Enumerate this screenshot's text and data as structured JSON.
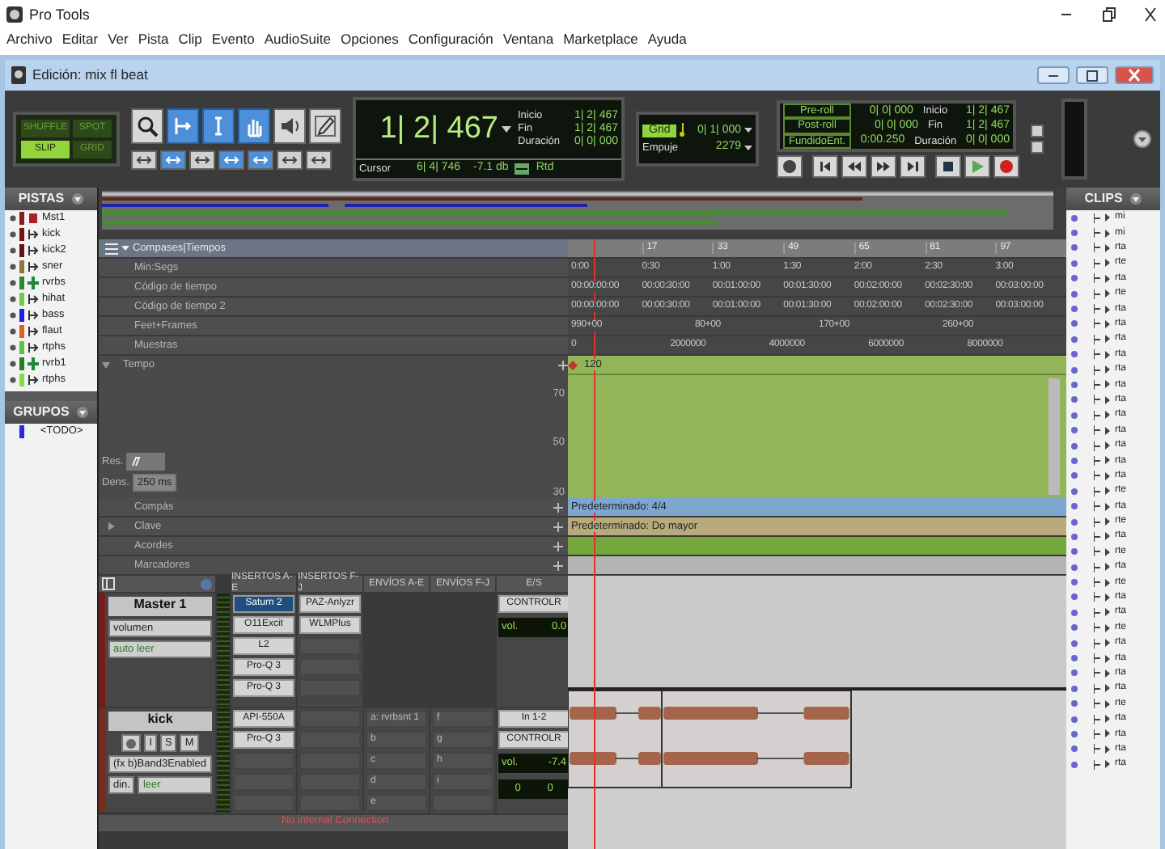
{
  "window": {
    "title": "Pro Tools"
  },
  "menu": [
    "Archivo",
    "Editar",
    "Ver",
    "Pista",
    "Clip",
    "Evento",
    "AudioSuite",
    "Opciones",
    "Configuración",
    "Ventana",
    "Marketplace",
    "Ayuda"
  ],
  "document": {
    "title": "Edición: mix fl beat"
  },
  "edit_modes": [
    {
      "label": "SHUFFLE",
      "selected": false
    },
    {
      "label": "SPOT",
      "selected": false
    },
    {
      "label": "SLIP",
      "selected": true
    },
    {
      "label": "GRID",
      "selected": false
    }
  ],
  "tools": [
    {
      "kind": "zoom",
      "selected": false
    },
    {
      "kind": "trim",
      "selected": true
    },
    {
      "kind": "selector",
      "selected": true
    },
    {
      "kind": "grabber",
      "selected": true
    },
    {
      "kind": "scrub",
      "selected": false
    },
    {
      "kind": "pencil",
      "selected": false
    }
  ],
  "edit_options": [
    {
      "selected": false
    },
    {
      "selected": true
    },
    {
      "selected": false
    },
    {
      "selected": true
    },
    {
      "selected": true
    },
    {
      "selected": false
    },
    {
      "selected": false
    }
  ],
  "counter": {
    "main": "1| 2| 467",
    "rows": [
      {
        "label": "Inicio",
        "value": "1| 2| 467"
      },
      {
        "label": "Fin",
        "value": "1| 2| 467"
      },
      {
        "label": "Duración",
        "value": "0| 0| 000"
      }
    ],
    "cursor_label": "Cursor",
    "cursor": "6| 4| 746",
    "db": "-7.1 db",
    "rtd": "Rtd"
  },
  "grid": {
    "label": "Grid",
    "value": "0| 1| 000"
  },
  "nudge": {
    "label": "Empuje",
    "value": "2279"
  },
  "transport_counter": {
    "rows": [
      {
        "label": "Pre-roll",
        "value": "0| 0| 000",
        "label2": "Inicio",
        "value2": "1| 2| 467"
      },
      {
        "label": "Post-roll",
        "value": "0| 0| 000",
        "label2": "Fin",
        "value2": "1| 2| 467"
      },
      {
        "label": "FundidoEnt.",
        "value": "0:00.250",
        "label2": "Duración",
        "value2": "0| 0| 000"
      }
    ]
  },
  "tracks_panel": {
    "title": "PISTAS",
    "tracks": [
      {
        "name": "Mst1",
        "kind": "master",
        "color": "#8b1a1a"
      },
      {
        "name": "kick",
        "kind": "audio",
        "color": "#7a1010"
      },
      {
        "name": "kick2",
        "kind": "audio",
        "color": "#6a1010"
      },
      {
        "name": "sner",
        "kind": "audio",
        "color": "#8a7a30"
      },
      {
        "name": "rvrbs",
        "kind": "aux",
        "color": "#2a8a2a"
      },
      {
        "name": "hihat",
        "kind": "audio",
        "color": "#6ad040"
      },
      {
        "name": "bass",
        "kind": "audio",
        "color": "#2020e0"
      },
      {
        "name": "flaut",
        "kind": "audio",
        "color": "#e06020"
      },
      {
        "name": "rtphs",
        "kind": "audio",
        "color": "#60c040"
      },
      {
        "name": "rvrb1",
        "kind": "aux",
        "color": "#208020"
      },
      {
        "name": "rtphs",
        "kind": "audio",
        "color": "#80e040"
      }
    ]
  },
  "groups_panel": {
    "title": "GRUPOS",
    "groups": [
      {
        "name": "<TODO>",
        "color": "#2a2ae0"
      }
    ]
  },
  "rulers": [
    {
      "kind": "bars",
      "label": "Compases|Tiempos",
      "ticks": [
        "17",
        "33",
        "49",
        "65",
        "81",
        "97"
      ]
    },
    {
      "kind": "time",
      "label": "Min:Segs",
      "ticks": [
        "0:00",
        "0:30",
        "1:00",
        "1:30",
        "2:00",
        "2:30",
        "3:00"
      ]
    },
    {
      "kind": "time",
      "label": "Código de tiempo",
      "ticks": [
        "00:00:00:00",
        "00:00:30:00",
        "00:01:00:00",
        "00:01:30:00",
        "00:02:00:00",
        "00:02:30:00",
        "00:03:00:00"
      ]
    },
    {
      "kind": "time",
      "label": "Código de tiempo 2",
      "ticks": [
        "00:00:00:00",
        "00:00:30:00",
        "00:01:00:00",
        "00:01:30:00",
        "00:02:00:00",
        "00:02:30:00",
        "00:03:00:00"
      ]
    },
    {
      "kind": "time",
      "label": "Feet+Frames",
      "ticks": [
        "990+00",
        "80+00",
        "170+00",
        "260+00"
      ]
    },
    {
      "kind": "time",
      "label": "Muestras",
      "ticks": [
        "0",
        "2000000",
        "4000000",
        "6000000",
        "8000000"
      ]
    }
  ],
  "tempo": {
    "label": "Tempo",
    "value": "120",
    "scale": [
      "70",
      "50",
      "30"
    ],
    "resolution_label": "Res.",
    "density_label": "Dens.",
    "density": "250 ms"
  },
  "conductor_rulers": [
    {
      "label": "Compás",
      "expandable": false,
      "value": "Predeterminado: 4/4",
      "color": "#7fa6cf"
    },
    {
      "label": "Clave",
      "expandable": true,
      "value": "Predeterminado: Do mayor",
      "color": "#b9aa7c"
    },
    {
      "label": "Acordes",
      "expandable": false,
      "color": "#74a83c"
    },
    {
      "label": "Marcadores",
      "expandable": false,
      "color": "#b4b4b4"
    }
  ],
  "mix_columns": [
    "INSERTOS A-E",
    "INSERTOS F-J",
    "ENVÍOS A-E",
    "ENVÍOS F-J",
    "E/S"
  ],
  "mix_tracks": [
    {
      "kind": "master",
      "name": "Master 1",
      "view": "volumen",
      "automation": "auto leer",
      "inserts_ae": [
        {
          "name": "Saturn 2",
          "selected": true
        },
        {
          "name": "O11Excit",
          "selected": false
        },
        {
          "name": "L2",
          "selected": false
        },
        {
          "name": "Pro-Q 3",
          "selected": false
        },
        {
          "name": "Pro-Q 3",
          "selected": false
        }
      ],
      "inserts_fj": [
        {
          "name": "PAZ-Anlyzr",
          "selected": false
        },
        {
          "name": "WLMPlus",
          "selected": false
        }
      ],
      "io": [
        "CONTROLR"
      ],
      "volume_label": "vol.",
      "volume": "0.0"
    },
    {
      "kind": "audio",
      "name": "kick",
      "buttons": [
        "I",
        "S",
        "M"
      ],
      "plugin_param": "(fx b)Band3Enabled",
      "dyn": "din.",
      "automation": "leer",
      "inserts_ae": [
        {
          "name": "API-550A",
          "selected": false
        },
        {
          "name": "Pro-Q 3",
          "selected": false
        }
      ],
      "sends_ae": [
        "a: rvrbsnt 1",
        "b",
        "c",
        "d",
        "e"
      ],
      "sends_fj": [
        "f",
        "g",
        "h",
        "i"
      ],
      "io": [
        "In 1-2",
        "CONTROLR"
      ],
      "volume_label": "vol.",
      "volume": "-7.4",
      "pan": [
        "0",
        "0"
      ]
    }
  ],
  "status": "No internal Connection",
  "clips_panel": {
    "title": "CLIPS",
    "clips": [
      "mi",
      "mi",
      "rta",
      "rte",
      "rta",
      "rte",
      "rta",
      "rta",
      "rta",
      "rta",
      "rta",
      "rta",
      "rta",
      "rta",
      "rta",
      "rta",
      "rta",
      "rta",
      "rte",
      "rta",
      "rte",
      "rta",
      "rte",
      "rta",
      "rte",
      "rta",
      "rta",
      "rte",
      "rta",
      "rta",
      "rta",
      "rta",
      "rte",
      "rta",
      "rta",
      "rta",
      "rta"
    ]
  }
}
